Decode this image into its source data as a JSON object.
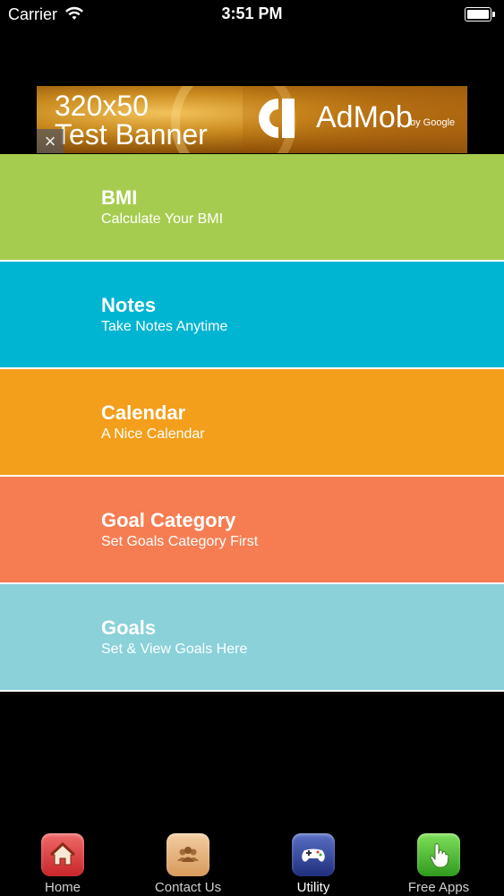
{
  "status_bar": {
    "carrier": "Carrier",
    "time": "3:51 PM"
  },
  "ad": {
    "size_text": "320x50",
    "label": "Test Banner",
    "brand": "AdMob",
    "brand_by": "by Google",
    "close_symbol": "×"
  },
  "menu": {
    "items": [
      {
        "title": "BMI",
        "subtitle": "Calculate Your BMI",
        "color": "#a6cc4f"
      },
      {
        "title": "Notes",
        "subtitle": "Take Notes Anytime",
        "color": "#00b5d2"
      },
      {
        "title": "Calendar",
        "subtitle": "A Nice Calendar",
        "color": "#f39f1b"
      },
      {
        "title": "Goal Category",
        "subtitle": "Set Goals Category First",
        "color": "#f67d52"
      },
      {
        "title": "Goals",
        "subtitle": "Set & View Goals Here",
        "color": "#8ad1da"
      }
    ]
  },
  "tab_bar": {
    "tabs": [
      {
        "label": "Home",
        "icon": "home-icon",
        "active": false
      },
      {
        "label": "Contact Us",
        "icon": "contacts-icon",
        "active": false
      },
      {
        "label": "Utility",
        "icon": "gamepad-icon",
        "active": true
      },
      {
        "label": "Free Apps",
        "icon": "touch-hand-icon",
        "active": false
      }
    ]
  }
}
